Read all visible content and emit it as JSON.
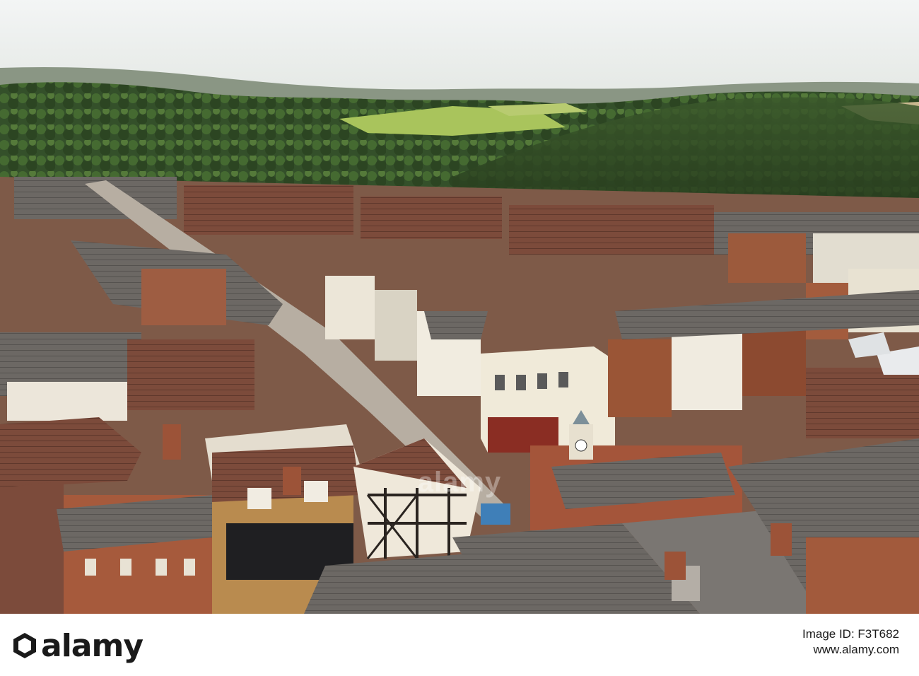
{
  "photo": {
    "subject": "aerial-town-view",
    "colors": {
      "sky": "#eef1f0",
      "hills": "#7d8a76",
      "forest_dark": "#2f4a24",
      "forest_mid": "#4d6b32",
      "field": "#a8c45a",
      "roof_tile": "#7a4a3a",
      "roof_slate": "#6e6a66",
      "brick": "#8e4d34",
      "render_white": "#ece6d8",
      "street": "#b9b0a4"
    }
  },
  "watermark": {
    "text": "alamy"
  },
  "stock_bar": {
    "logo_text": "alamy",
    "meta_line": "Image ID: F3T682",
    "url": "www.alamy.com",
    "image_id": "F3T682"
  }
}
